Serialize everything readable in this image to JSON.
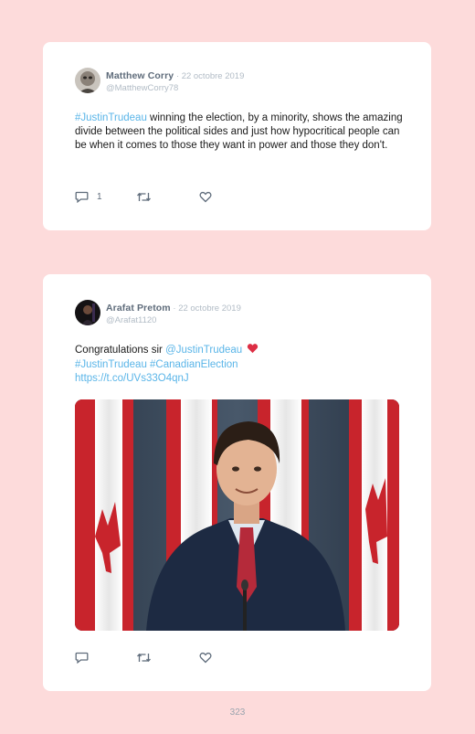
{
  "tweets": [
    {
      "name": "Matthew Corry",
      "separator": " · ",
      "date": "22 octobre 2019",
      "handle": "@MatthewCorry78",
      "text_link": "#JustinTrudeau",
      "text_rest": " winning the election, by a minority, shows the amazing divide between the political sides and just how hypocritical people can be when it comes to those they want in power and those they don't.",
      "reply_count": "1",
      "icons": [
        "reply-icon",
        "retweet-icon",
        "like-icon"
      ]
    },
    {
      "name": "Arafat Pretom",
      "separator": " · ",
      "date": "22 octobre 2019",
      "handle": "@Arafat1120",
      "text_plain": "Congratulations sir ",
      "mention": "@JustinTrudeau",
      "hashtags": "#JustinTrudeau #CanadianElection",
      "url": "https://t.co/UVs33O4qnJ",
      "icons": [
        "reply-icon",
        "retweet-icon",
        "like-icon",
        "heart-emoji"
      ],
      "accent_heart": "#dd2e44"
    }
  ],
  "page_number": "323",
  "colors": {
    "background": "#fddbdb",
    "card": "#ffffff",
    "link": "#5ab5e8",
    "muted": "#b2bcc6",
    "name": "#5f6c7b"
  }
}
